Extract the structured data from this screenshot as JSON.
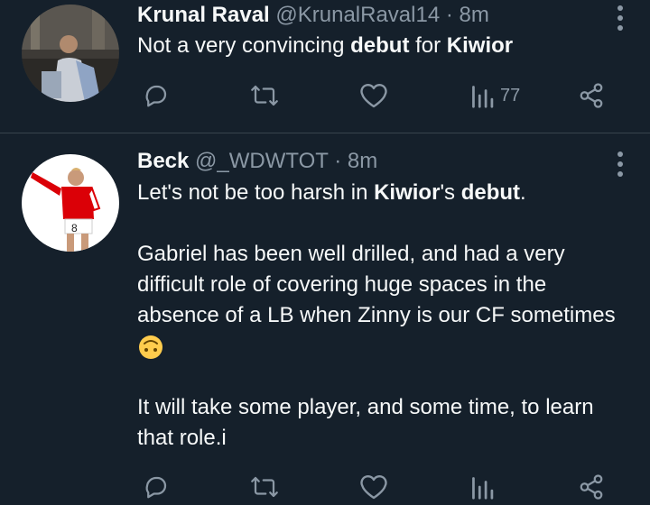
{
  "tweets": [
    {
      "name": "Krunal Raval",
      "handle": "@KrunalRaval14",
      "time": "8m",
      "text": {
        "part1": "Not a very convincing ",
        "bold1": "debut",
        "part2": " for ",
        "bold2": "Kiwior"
      },
      "actions": {
        "views": "77"
      }
    },
    {
      "name": "Beck",
      "handle": "@_WDWTOT",
      "time": "8m",
      "text": {
        "line1_a": "Let's not be too harsh in ",
        "line1_bold1": "Kiwior",
        "line1_b": "'s ",
        "line1_bold2": "debut",
        "line1_c": ".",
        "para2": "Gabriel has been well drilled, and had a very difficult role of covering huge spaces in the absence of a LB when Zinny is our CF sometimes",
        "para3": "It will take some player, and some time, to learn that role.i"
      }
    }
  ],
  "icons": [
    "reply-icon",
    "retweet-icon",
    "like-icon",
    "views-icon",
    "share-icon",
    "more-icon",
    "upside-down-face-emoji"
  ],
  "colors": {
    "background": "#15202b",
    "text": "#f7f9f9",
    "muted": "#8b98a5",
    "divider": "#38444d"
  }
}
